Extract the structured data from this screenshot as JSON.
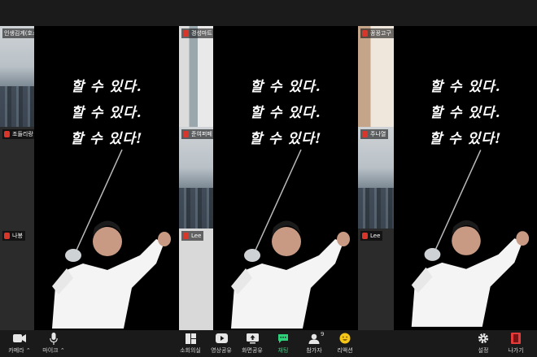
{
  "participants": {
    "top_left_name": "인생김게(호스",
    "mid_left_name": "조들리랑",
    "bottom_left_name": "나봉",
    "top_mid_name": "경성마트",
    "mid_mid_name": "준여퍼페",
    "bottom_mid_name": "Lee",
    "top_right_name": "꽁꽁고구",
    "mid_right_name": "주나열",
    "bottom_right_name": "Lee"
  },
  "share": {
    "line1": "할 수 있다.",
    "line2": "할 수 있다.",
    "line3": "할 수 있다!"
  },
  "toolbar": {
    "camera": "카메라",
    "mic": "마이크",
    "breakout": "소회의실",
    "video_share": "영상공유",
    "screen_share": "화면공유",
    "chat": "채팅",
    "participants": "참가자",
    "participants_count": "9",
    "reactions": "리액션",
    "settings": "설정",
    "leave": "나가기"
  },
  "colors": {
    "chat_active": "#2fd07a",
    "leave": "#e23b3b",
    "muted": "#d9362b"
  }
}
